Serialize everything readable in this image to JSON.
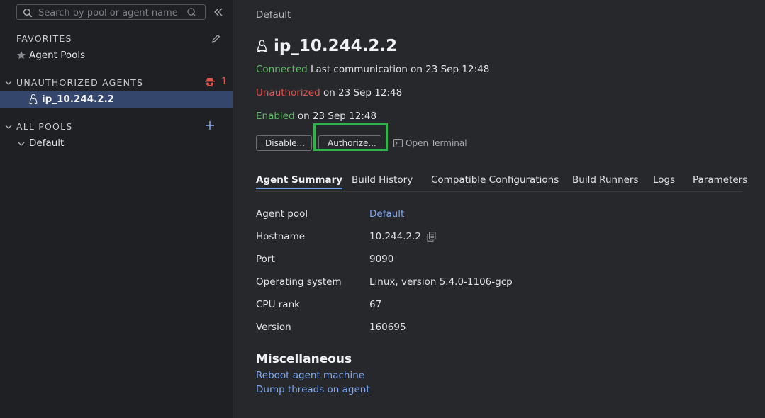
{
  "sidebar": {
    "search": {
      "placeholder": "Search by pool or agent name"
    },
    "favorites": {
      "title": "FAVORITES",
      "items": [
        {
          "label": "Agent Pools"
        }
      ]
    },
    "unauthorized": {
      "title": "UNAUTHORIZED AGENTS",
      "count": "1",
      "items": [
        {
          "label": "ip_10.244.2.2"
        }
      ]
    },
    "all_pools": {
      "title": "ALL POOLS",
      "items": [
        {
          "label": "Default"
        }
      ]
    }
  },
  "main": {
    "breadcrumb": "Default",
    "title": "ip_10.244.2.2",
    "status": {
      "connected_label": "Connected",
      "connected_text": "Last communication on 23 Sep 12:48",
      "unauthorized_label": "Unauthorized",
      "unauthorized_text": "on 23 Sep 12:48",
      "enabled_label": "Enabled",
      "enabled_text": "on 23 Sep 12:48"
    },
    "buttons": {
      "disable": "Disable...",
      "authorize": "Authorize...",
      "terminal": "Open Terminal"
    },
    "tabs": [
      {
        "label": "Agent Summary"
      },
      {
        "label": "Build History"
      },
      {
        "label": "Compatible Configurations"
      },
      {
        "label": "Build Runners"
      },
      {
        "label": "Logs"
      },
      {
        "label": "Parameters"
      }
    ],
    "summary": [
      {
        "label": "Agent pool",
        "value": "Default"
      },
      {
        "label": "Hostname",
        "value": "10.244.2.2"
      },
      {
        "label": "Port",
        "value": "9090"
      },
      {
        "label": "Operating system",
        "value": "Linux, version 5.4.0-1106-gcp"
      },
      {
        "label": "CPU rank",
        "value": "67"
      },
      {
        "label": "Version",
        "value": "160695"
      }
    ],
    "misc": {
      "title": "Miscellaneous",
      "links": [
        {
          "label": "Reboot agent machine"
        },
        {
          "label": "Dump threads on agent"
        }
      ]
    }
  },
  "colors": {
    "accent_green": "#5fb865",
    "danger_red": "#e5534b",
    "link_blue": "#7ea6f2",
    "highlight_green": "#2fb34a"
  }
}
